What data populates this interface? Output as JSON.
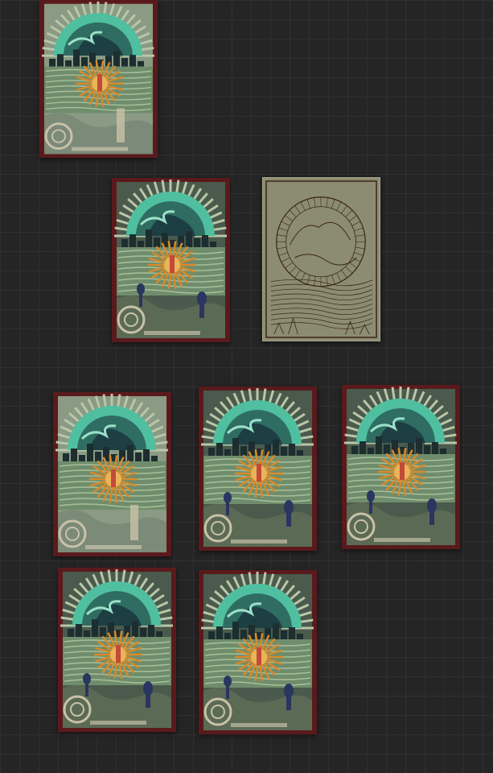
{
  "canvas": {
    "background": "#252525",
    "grid_color": "#303030"
  },
  "images": [
    {
      "name": "artwork-thumbnail-1",
      "variant": "collage"
    },
    {
      "name": "artwork-thumbnail-2",
      "variant": "painted"
    },
    {
      "name": "artwork-sketch",
      "variant": "sketch"
    },
    {
      "name": "artwork-thumbnail-3",
      "variant": "collage"
    },
    {
      "name": "artwork-thumbnail-4",
      "variant": "painted"
    },
    {
      "name": "artwork-thumbnail-5",
      "variant": "painted"
    },
    {
      "name": "artwork-thumbnail-6",
      "variant": "painted"
    },
    {
      "name": "artwork-thumbnail-7",
      "variant": "painted"
    }
  ],
  "colors": {
    "frame_red": "#5a1a1c",
    "wave_teal": "#4fbfa0",
    "sun_orange": "#d88a2a",
    "water_green": "#6f8d6c",
    "sketch_paper": "#8c8c72",
    "sketch_ink": "#3a2416"
  }
}
